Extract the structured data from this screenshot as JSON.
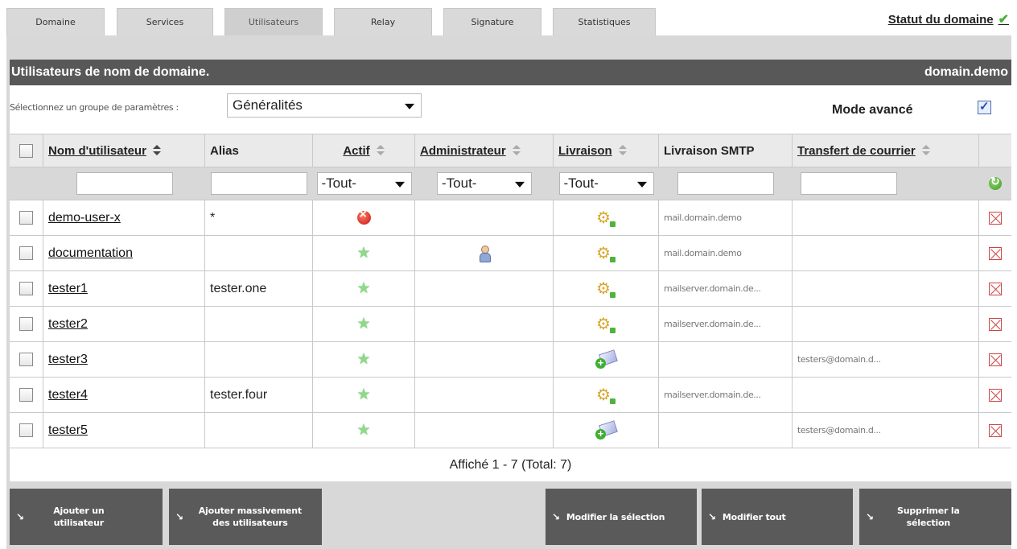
{
  "tabs": [
    {
      "label": "Domaine"
    },
    {
      "label": "Services"
    },
    {
      "label": "Utilisateurs"
    },
    {
      "label": "Relay"
    },
    {
      "label": "Signature"
    },
    {
      "label": "Statistiques"
    }
  ],
  "active_tab": "Utilisateurs",
  "status_link": "Statut du domaine",
  "header": {
    "title": "Utilisateurs de nom de domaine.",
    "domain": "domain.demo"
  },
  "params": {
    "label": "Sélectionnez un groupe de paramètres :",
    "selected": "Généralités",
    "mode_label": "Mode avancé",
    "mode_checked": true
  },
  "columns": {
    "username": "Nom d'utilisateur",
    "alias": "Alias",
    "active": "Actif",
    "admin": "Administrateur",
    "delivery": "Livraison",
    "smtp": "Livraison SMTP",
    "forward": "Transfert de courrier"
  },
  "filters": {
    "active": "-Tout-",
    "admin": "-Tout-",
    "delivery": "-Tout-"
  },
  "rows": [
    {
      "username": "demo-user-x",
      "alias": "*",
      "active": "inactive-icon",
      "admin": "",
      "delivery": "relay-icon",
      "smtp": "mail.domain.demo",
      "forward": ""
    },
    {
      "username": "documentation",
      "alias": "",
      "active": "star-icon",
      "admin": "admin-icon",
      "delivery": "relay-icon",
      "smtp": "mail.domain.demo",
      "forward": ""
    },
    {
      "username": "tester1",
      "alias": "tester.one",
      "active": "star-icon",
      "admin": "",
      "delivery": "relay-icon",
      "smtp": "mailserver.domain.de...",
      "forward": ""
    },
    {
      "username": "tester2",
      "alias": "",
      "active": "star-icon",
      "admin": "",
      "delivery": "relay-icon",
      "smtp": "mailserver.domain.de...",
      "forward": ""
    },
    {
      "username": "tester3",
      "alias": "",
      "active": "star-icon",
      "admin": "",
      "delivery": "mailbox-icon",
      "smtp": "",
      "forward": "testers@domain.d..."
    },
    {
      "username": "tester4",
      "alias": "tester.four",
      "active": "star-icon",
      "admin": "",
      "delivery": "relay-icon",
      "smtp": "mailserver.domain.de...",
      "forward": ""
    },
    {
      "username": "tester5",
      "alias": "",
      "active": "star-icon",
      "admin": "",
      "delivery": "mailbox-icon",
      "smtp": "",
      "forward": "testers@domain.d..."
    }
  ],
  "footer": "Affiché 1 - 7 (Total: 7)",
  "buttons": {
    "add_user": "Ajouter un utilisateur",
    "bulk_add": "Ajouter massivement des utilisateurs",
    "edit_selection": "Modifier la sélection",
    "edit_all": "Modifier tout",
    "delete_selection": "Supprimer la sélection"
  },
  "colors": {
    "header_bg": "#585858",
    "frame_bg": "#d8d8d8",
    "button_bg": "#5a5a5a",
    "status_check": "#4caf3a"
  }
}
